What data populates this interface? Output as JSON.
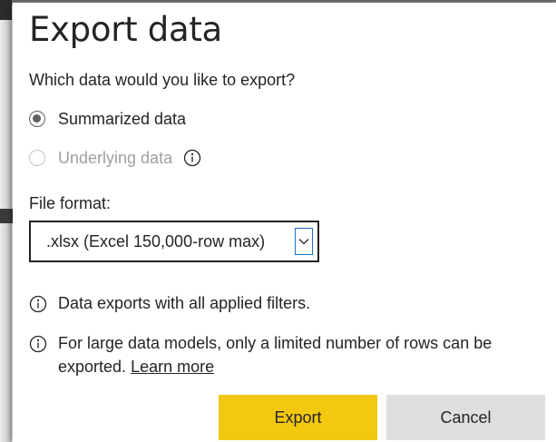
{
  "dialog": {
    "title": "Export data",
    "question": "Which data would you like to export?",
    "options": [
      {
        "label": "Summarized data",
        "selected": true,
        "enabled": true
      },
      {
        "label": "Underlying data",
        "selected": false,
        "enabled": false,
        "info_icon": "info-icon"
      }
    ],
    "file_format": {
      "label": "File format:",
      "selected": ".xlsx (Excel 150,000-row max)",
      "chevron_icon": "chevron-down-icon"
    },
    "notes": [
      {
        "icon": "info-icon",
        "text": "Data exports with all applied filters."
      },
      {
        "icon": "info-icon",
        "text_before": "For large data models, only a limited number of rows can be exported. ",
        "link": "Learn more"
      }
    ],
    "buttons": {
      "export_label": "Export",
      "cancel_label": "Cancel"
    }
  },
  "colors": {
    "primary_button": "#f2c811",
    "secondary_button": "#e1dfdd",
    "text": "#252423",
    "disabled_text": "#a19f9d",
    "focus_border": "#1a73c9"
  }
}
